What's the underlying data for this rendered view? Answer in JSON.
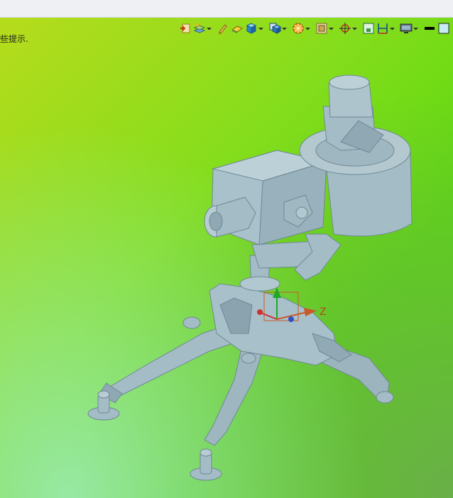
{
  "hint_text": "些提示.",
  "axis": {
    "z_label": "Z"
  },
  "toolbar": {
    "items": [
      {
        "icon": "exit-sketch-icon",
        "has_dropdown": false
      },
      {
        "icon": "layer-icon",
        "has_dropdown": true
      },
      {
        "icon": "pencil-icon",
        "has_dropdown": false
      },
      {
        "icon": "surface-icon",
        "has_dropdown": false
      },
      {
        "icon": "cube-icon",
        "has_dropdown": true
      },
      {
        "icon": "view-cube-icon",
        "has_dropdown": true
      },
      {
        "icon": "render-icon",
        "has_dropdown": true
      },
      {
        "icon": "section-icon",
        "has_dropdown": true
      },
      {
        "icon": "orient-icon",
        "has_dropdown": true
      },
      {
        "icon": "fit-view-icon",
        "has_dropdown": false
      },
      {
        "icon": "measure-icon",
        "has_dropdown": true
      },
      {
        "icon": "display-icon",
        "has_dropdown": true
      },
      {
        "icon": "color-black-swatch",
        "has_dropdown": false
      },
      {
        "icon": "color-lightblue-swatch",
        "has_dropdown": false
      }
    ]
  },
  "colors": {
    "model": "#a4bcc6",
    "model_shadow": "#7c97a3",
    "bg_start": "#b6dc1c",
    "bg_end": "#57d904"
  }
}
